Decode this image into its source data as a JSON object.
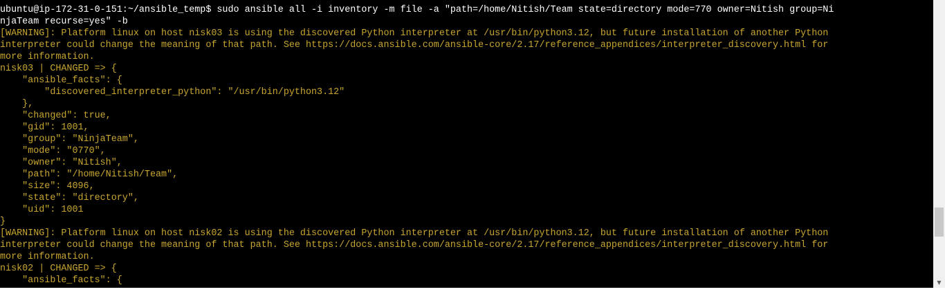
{
  "terminal": {
    "lines": [
      {
        "text": "ubuntu@ip-172-31-0-151:~/ansible_temp$ sudo ansible all -i inventory -m file -a \"path=/home/Nitish/Team state=directory mode=770 owner=Nitish group=Ni",
        "color": "white"
      },
      {
        "text": "njaTeam recurse=yes\" -b",
        "color": "white"
      },
      {
        "text": "[WARNING]: Platform linux on host nisk03 is using the discovered Python interpreter at /usr/bin/python3.12, but future installation of another Python",
        "color": "yellow"
      },
      {
        "text": "interpreter could change the meaning of that path. See https://docs.ansible.com/ansible-core/2.17/reference_appendices/interpreter_discovery.html for",
        "color": "yellow"
      },
      {
        "text": "more information.",
        "color": "yellow"
      },
      {
        "text": "nisk03 | CHANGED => {",
        "color": "yellow"
      },
      {
        "text": "    \"ansible_facts\": {",
        "color": "yellow"
      },
      {
        "text": "        \"discovered_interpreter_python\": \"/usr/bin/python3.12\"",
        "color": "yellow"
      },
      {
        "text": "    },",
        "color": "yellow"
      },
      {
        "text": "    \"changed\": true,",
        "color": "yellow"
      },
      {
        "text": "    \"gid\": 1001,",
        "color": "yellow"
      },
      {
        "text": "    \"group\": \"NinjaTeam\",",
        "color": "yellow"
      },
      {
        "text": "    \"mode\": \"0770\",",
        "color": "yellow"
      },
      {
        "text": "    \"owner\": \"Nitish\",",
        "color": "yellow"
      },
      {
        "text": "    \"path\": \"/home/Nitish/Team\",",
        "color": "yellow"
      },
      {
        "text": "    \"size\": 4096,",
        "color": "yellow"
      },
      {
        "text": "    \"state\": \"directory\",",
        "color": "yellow"
      },
      {
        "text": "    \"uid\": 1001",
        "color": "yellow"
      },
      {
        "text": "}",
        "color": "yellow"
      },
      {
        "text": "[WARNING]: Platform linux on host nisk02 is using the discovered Python interpreter at /usr/bin/python3.12, but future installation of another Python",
        "color": "yellow"
      },
      {
        "text": "interpreter could change the meaning of that path. See https://docs.ansible.com/ansible-core/2.17/reference_appendices/interpreter_discovery.html for",
        "color": "yellow"
      },
      {
        "text": "more information.",
        "color": "yellow"
      },
      {
        "text": "nisk02 | CHANGED => {",
        "color": "yellow"
      },
      {
        "text": "    \"ansible_facts\": {",
        "color": "yellow"
      }
    ]
  },
  "colors": {
    "background": "#000000",
    "prompt_text": "#ffffff",
    "output_text": "#c8a630",
    "scrollbar_track": "#f0f0f0",
    "scrollbar_thumb": "#c8c8c8"
  },
  "scrollbar": {
    "down_arrow_icon": "triangle-down-icon"
  }
}
